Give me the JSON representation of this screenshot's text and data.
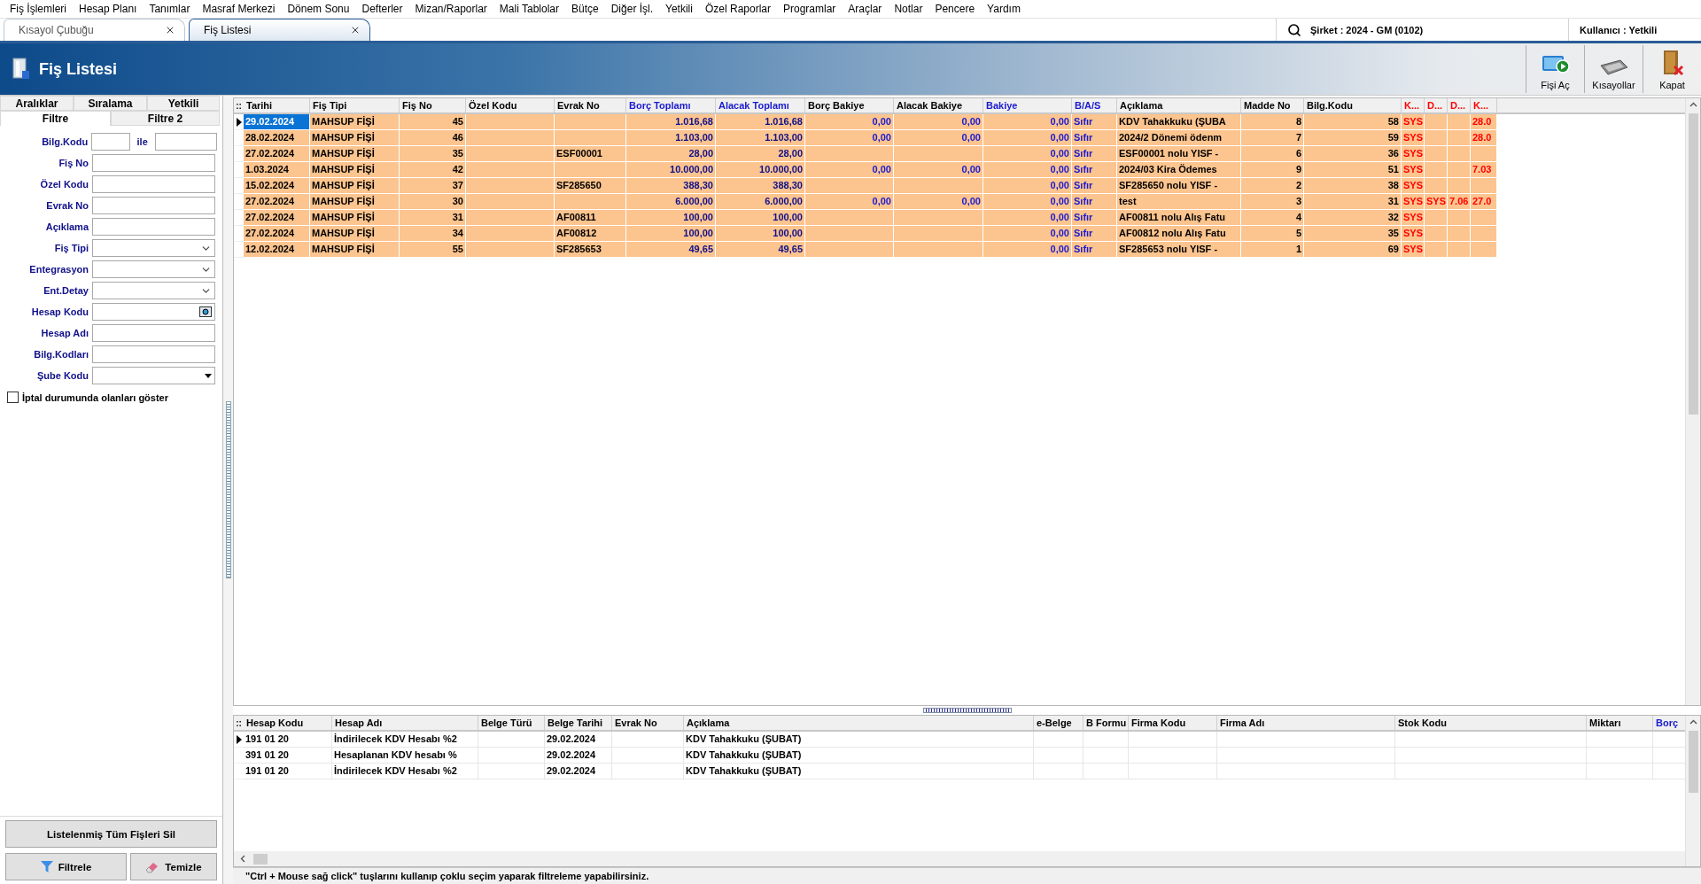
{
  "menu": [
    "Fiş İşlemleri",
    "Hesap Planı",
    "Tanımlar",
    "Masraf Merkezi",
    "Dönem Sonu",
    "Defterler",
    "Mizan/Raporlar",
    "Mali Tablolar",
    "Bütçe",
    "Diğer İşl.",
    "Yetkili",
    "Özel Raporlar",
    "Programlar",
    "Araçlar",
    "Notlar",
    "Pencere",
    "Yardım"
  ],
  "tabs": [
    {
      "label": "Kısayol Çubuğu",
      "selected": false
    },
    {
      "label": "Fiş Listesi",
      "selected": true
    }
  ],
  "company": "Şirket : 2024 - GM (0102)",
  "user": "Kullanıcı : Yetkili",
  "page": {
    "title": "Fiş Listesi",
    "actions": [
      {
        "kind": "open",
        "label": "Fişi Aç"
      },
      {
        "kind": "shortcuts",
        "label": "Kısayollar"
      },
      {
        "kind": "close",
        "label": "Kapat"
      }
    ]
  },
  "filter_panel": {
    "tab_rows": [
      [
        {
          "label": "Aralıklar",
          "selected": false
        },
        {
          "label": "Sıralama",
          "selected": false
        },
        {
          "label": "Yetkili",
          "selected": false
        }
      ],
      [
        {
          "label": "Filtre",
          "selected": true
        },
        {
          "label": "Filtre 2",
          "selected": false
        }
      ]
    ],
    "fields": [
      {
        "label": "Bilg.Kodu",
        "kind": "range",
        "joiner": "ile"
      },
      {
        "label": "Fiş No",
        "kind": "text"
      },
      {
        "label": "Özel Kodu",
        "kind": "text"
      },
      {
        "label": "Evrak No",
        "kind": "text"
      },
      {
        "label": "Açıklama",
        "kind": "text"
      },
      {
        "label": "Fiş Tipi",
        "kind": "select"
      },
      {
        "label": "Entegrasyon",
        "kind": "select"
      },
      {
        "label": "Ent.Detay",
        "kind": "select"
      },
      {
        "label": "Hesap Kodu",
        "kind": "lookup"
      },
      {
        "label": "Hesap Adı",
        "kind": "text"
      },
      {
        "label": "Bilg.Kodları",
        "kind": "text"
      },
      {
        "label": "Şube Kodu",
        "kind": "combo"
      }
    ],
    "checkbox": {
      "label": "İptal durumunda olanları göster",
      "checked": false
    },
    "buttons": {
      "clear_all": "Listelenmiş Tüm Fişleri Sil",
      "filter": "Filtrele",
      "reset": "Temizle"
    }
  },
  "list": {
    "corner": "::",
    "columns": [
      {
        "label": "Tarihi",
        "kind": "text",
        "color": "#000000"
      },
      {
        "label": "Fiş Tipi",
        "kind": "text",
        "color": "#000000"
      },
      {
        "label": "Fiş No",
        "kind": "number",
        "color": "#000000"
      },
      {
        "label": "Özel Kodu",
        "kind": "text",
        "color": "#000000"
      },
      {
        "label": "Evrak No",
        "kind": "text",
        "color": "#000000"
      },
      {
        "label": "Borç Toplamı",
        "kind": "amount",
        "color": "#1a1ad0"
      },
      {
        "label": "Alacak Toplamı",
        "kind": "amount",
        "color": "#1a1ad0"
      },
      {
        "label": "Borç Bakiye",
        "kind": "balance",
        "color": "#000000"
      },
      {
        "label": "Alacak Bakiye",
        "kind": "balance",
        "color": "#000000"
      },
      {
        "label": "Bakiye",
        "kind": "balance",
        "color": "#1a1ad0"
      },
      {
        "label": "B/A/S",
        "kind": "status",
        "color": "#1a1ad0"
      },
      {
        "label": "Açıklama",
        "kind": "text",
        "color": "#000000"
      },
      {
        "label": "Madde No",
        "kind": "number",
        "color": "#000000"
      },
      {
        "label": "Bilg.Kodu",
        "kind": "number",
        "color": "#000000"
      },
      {
        "label": "K...",
        "kind": "flag",
        "color": "#ff0000"
      },
      {
        "label": "D...",
        "kind": "flag",
        "color": "#ff0000"
      },
      {
        "label": "D...",
        "kind": "flag",
        "color": "#ff0000"
      },
      {
        "label": "K...",
        "kind": "flag",
        "color": "#ff0000"
      }
    ],
    "rows": [
      {
        "selected": true,
        "cells": [
          "29.02.2024",
          "MAHSUP FİŞİ",
          "45",
          "",
          "",
          "1.016,68",
          "1.016,68",
          "0,00",
          "0,00",
          "0,00",
          "Sıfır",
          "KDV Tahakkuku (ŞUBA",
          "8",
          "58",
          "SYS",
          "",
          "",
          "28.0"
        ]
      },
      {
        "selected": false,
        "cells": [
          "28.02.2024",
          "MAHSUP FİŞİ",
          "46",
          "",
          "",
          "1.103,00",
          "1.103,00",
          "0,00",
          "0,00",
          "0,00",
          "Sıfır",
          "2024/2 Dönemi ödenm",
          "7",
          "59",
          "SYS",
          "",
          "",
          "28.0"
        ]
      },
      {
        "selected": false,
        "cells": [
          "27.02.2024",
          "MAHSUP FİŞİ",
          "35",
          "",
          "ESF00001",
          "28,00",
          "28,00",
          "",
          "",
          "0,00",
          "Sıfır",
          "ESF00001 nolu YISF -",
          "6",
          "36",
          "SYS",
          "",
          "",
          ""
        ]
      },
      {
        "selected": false,
        "cells": [
          "1.03.2024",
          "MAHSUP FİŞİ",
          "42",
          "",
          "",
          "10.000,00",
          "10.000,00",
          "0,00",
          "0,00",
          "0,00",
          "Sıfır",
          "2024/03 Kira Ödemes",
          "9",
          "51",
          "SYS",
          "",
          "",
          "7.03"
        ]
      },
      {
        "selected": false,
        "cells": [
          "15.02.2024",
          "MAHSUP FİŞİ",
          "37",
          "",
          "SF285650",
          "388,30",
          "388,30",
          "",
          "",
          "0,00",
          "Sıfır",
          "SF285650 nolu YISF -",
          "2",
          "38",
          "SYS",
          "",
          "",
          ""
        ]
      },
      {
        "selected": false,
        "cells": [
          "27.02.2024",
          "MAHSUP FİŞİ",
          "30",
          "",
          "",
          "6.000,00",
          "6.000,00",
          "0,00",
          "0,00",
          "0,00",
          "Sıfır",
          "test",
          "3",
          "31",
          "SYS",
          "SYS",
          "7.06",
          "27.0"
        ]
      },
      {
        "selected": false,
        "cells": [
          "27.02.2024",
          "MAHSUP FİŞİ",
          "31",
          "",
          "AF00811",
          "100,00",
          "100,00",
          "",
          "",
          "0,00",
          "Sıfır",
          "AF00811 nolu Alış Fatu",
          "4",
          "32",
          "SYS",
          "",
          "",
          ""
        ]
      },
      {
        "selected": false,
        "cells": [
          "27.02.2024",
          "MAHSUP FİŞİ",
          "34",
          "",
          "AF00812",
          "100,00",
          "100,00",
          "",
          "",
          "0,00",
          "Sıfır",
          "AF00812 nolu Alış Fatu",
          "5",
          "35",
          "SYS",
          "",
          "",
          ""
        ]
      },
      {
        "selected": false,
        "cells": [
          "12.02.2024",
          "MAHSUP FİŞİ",
          "55",
          "",
          "SF285653",
          "49,65",
          "49,65",
          "",
          "",
          "0,00",
          "Sıfır",
          "SF285653 nolu YISF -",
          "1",
          "69",
          "SYS",
          "",
          "",
          ""
        ]
      }
    ]
  },
  "details": {
    "corner": "::",
    "columns": [
      {
        "label": "Hesap Kodu",
        "color": "#000000"
      },
      {
        "label": "Hesap Adı",
        "color": "#000000"
      },
      {
        "label": "Belge Türü",
        "color": "#000000"
      },
      {
        "label": "Belge Tarihi",
        "color": "#000000"
      },
      {
        "label": "Evrak No",
        "color": "#000000"
      },
      {
        "label": "Açıklama",
        "color": "#000000"
      },
      {
        "label": "e-Belge",
        "color": "#000000"
      },
      {
        "label": "B Formu",
        "color": "#000000"
      },
      {
        "label": "Firma Kodu",
        "color": "#000000"
      },
      {
        "label": "Firma Adı",
        "color": "#000000"
      },
      {
        "label": "Stok Kodu",
        "color": "#000000"
      },
      {
        "label": "Miktarı",
        "color": "#000000"
      },
      {
        "label": "Borç",
        "color": "#1a1ad0"
      }
    ],
    "rows": [
      {
        "selected": true,
        "cells": [
          "191 01 20",
          "İndirilecek KDV Hesabı %2",
          "",
          "29.02.2024",
          "",
          "KDV Tahakkuku (ŞUBAT)",
          "",
          "",
          "",
          "",
          "",
          "",
          ""
        ]
      },
      {
        "selected": false,
        "cells": [
          "391 01 20",
          "Hesaplanan KDV hesabı %",
          "",
          "29.02.2024",
          "",
          "KDV Tahakkuku (ŞUBAT)",
          "",
          "",
          "",
          "",
          "",
          "",
          ""
        ]
      },
      {
        "selected": false,
        "cells": [
          "191 01 20",
          "İndirilecek KDV Hesabı %2",
          "",
          "29.02.2024",
          "",
          "KDV Tahakkuku (ŞUBAT)",
          "",
          "",
          "",
          "",
          "",
          "",
          ""
        ]
      }
    ]
  },
  "status_bar": "\"Ctrl + Mouse sağ click\" tuşlarını kullanıp çoklu seçim yaparak filtreleme yapabilirsiniz."
}
